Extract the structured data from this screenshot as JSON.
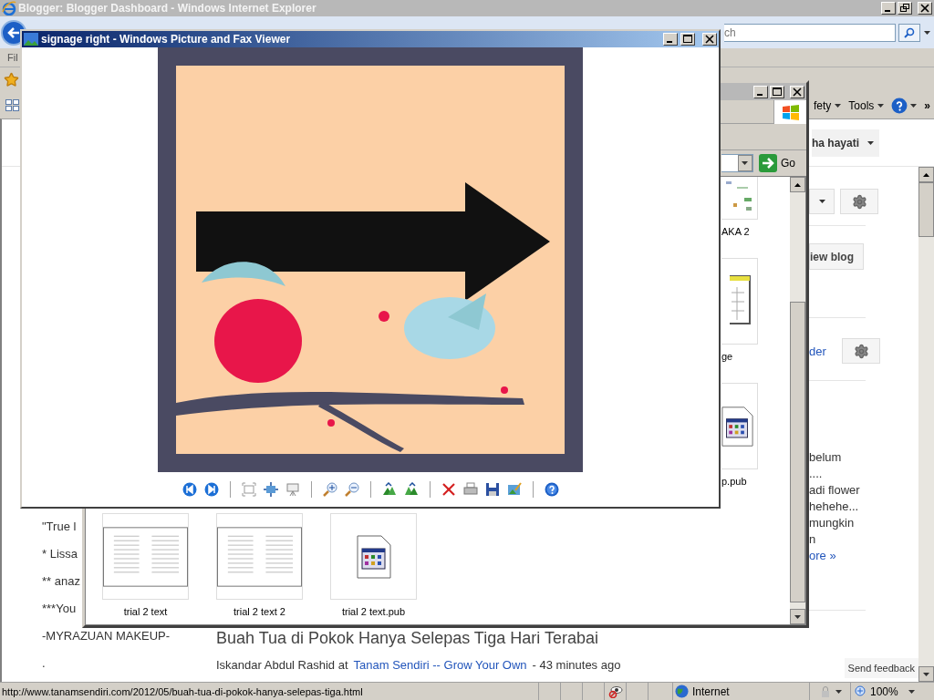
{
  "ie_window": {
    "title": "Blogger: Blogger Dashboard - Windows Internet Explorer",
    "active": false,
    "search": {
      "value": "ch"
    },
    "menu_bar": [
      "Fil"
    ],
    "command_bar": [
      {
        "label": "fety"
      },
      {
        "label": "Tools"
      }
    ],
    "more": "»"
  },
  "blogger": {
    "account": "ha hayati",
    "view_blog": "iew blog",
    "reader_link": "der",
    "snippet": [
      "belum",
      "....",
      "adi flower",
      "hehehe...",
      "mungkin",
      "n"
    ],
    "more_link": "ore »",
    "send_feedback": "Send feedback",
    "left_column": [
      "\"True l",
      "* Lissa",
      "** anaz",
      "***You",
      "-MYRAZUAN MAKEUP-",
      "."
    ],
    "post": {
      "title": "Buah Tua di Pokok Hanya Selepas Tiga Hari Terabai",
      "author": "Iskandar Abdul Rashid at",
      "blog": "Tanam Sendiri -- Grow Your Own",
      "time": "- 43 minutes ago"
    }
  },
  "status_bar": {
    "url": "http://www.tanamsendiri.com/2012/05/buah-tua-di-pokok-hanya-selepas-tiga.html",
    "zone": "Internet",
    "zoom": "100%"
  },
  "explorer_window": {
    "active": false,
    "go": "Go",
    "side_tiles": [
      {
        "label": "AKA 2",
        "kind": "diagram"
      },
      {
        "label": "ge",
        "kind": "calendar"
      },
      {
        "label": "p.pub",
        "kind": "pub"
      }
    ],
    "tiles": [
      {
        "label": "trial 2 text",
        "kind": "document"
      },
      {
        "label": "trial 2 text 2",
        "kind": "document"
      },
      {
        "label": "trial 2 text.pub",
        "kind": "pub"
      }
    ]
  },
  "viewer_window": {
    "title": "signage right - Windows Picture and Fax Viewer",
    "active": true
  }
}
